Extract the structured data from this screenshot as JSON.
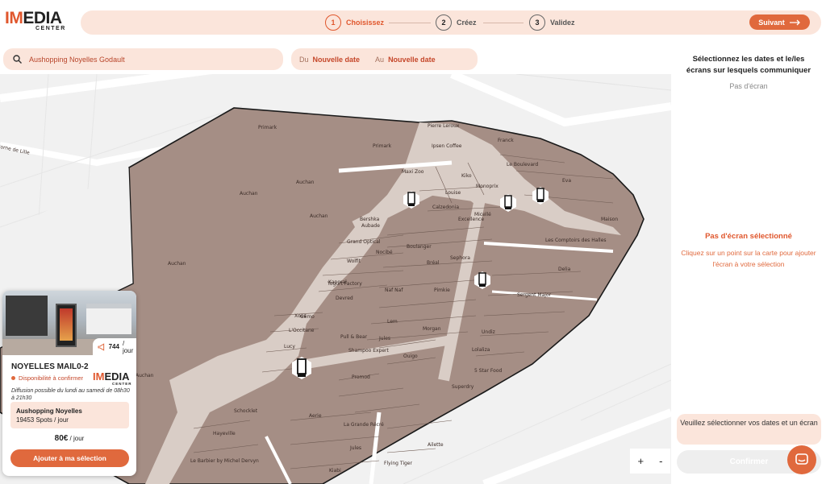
{
  "brand": {
    "logo_letters_red": "IM",
    "logo_letters_dark": "EDIA",
    "logo_sub": "CENTER"
  },
  "stepper": {
    "steps": [
      {
        "num": "1",
        "label": "Choisissez"
      },
      {
        "num": "2",
        "label": "Créez"
      },
      {
        "num": "3",
        "label": "Validez"
      }
    ],
    "next_label": "Suivant",
    "next_icon": "arrow-right-icon"
  },
  "search": {
    "icon": "search-icon",
    "value": "Aushopping Noyelles Godault"
  },
  "dates": {
    "from_prefix": "Du",
    "from_value": "Nouvelle date",
    "to_prefix": "Au",
    "to_value": "Nouvelle date"
  },
  "map": {
    "labels": [
      "Primark",
      "Primark",
      "Pierre Leroux",
      "Ipsen Coffee",
      "Franck",
      "Le Boulevard",
      "Eva",
      "Auchan",
      "Auchan",
      "Auchan",
      "Auchan",
      "Auchan",
      "Maxi Zoo",
      "Louise",
      "Kiko",
      "Monoprix",
      "Calzedonia",
      "Excellence",
      "Micellé",
      "Aubade",
      "Grand Optical",
      "Boulanger",
      "Nocibé",
      "Wolfit",
      "Bréal",
      "Sephora",
      "Les Comptoirs des Halles",
      "Delia",
      "Kaporal",
      "Naf Naf",
      "Pimkie",
      "Sergent Major",
      "Devred",
      "Yogurt Factory",
      "Xoos",
      "Lem",
      "Morgan",
      "Pull & Bear",
      "Jules",
      "Shampoo Expert",
      "Ouigo",
      "Undiz",
      "Lolaliza",
      "5 Star Food",
      "Superdry",
      "Promod",
      "Aerie",
      "Flying Tiger",
      "Jules",
      "Kiabi",
      "Le Barbier by Michel Dervyn",
      "Ailette",
      "Hayeville",
      "Schocklet",
      "La Grande Récré",
      "Bershka",
      "Gémo",
      "Lucy",
      "L'Occitane",
      "Maison"
    ],
    "road_label": "Borne de Lille"
  },
  "card": {
    "spots_per_day": "744",
    "spots_suffix": "/ jour",
    "spot_icon": "megaphone-icon",
    "name": "NOYELLES MAIL0-2",
    "status": "Disponibilité à confirmer",
    "diffusion": "Diffusion possible du lundi au samedi de 08h30 à 21h30",
    "mall_name": "Aushopping Noyelles",
    "spots_line": "19453 Spots / jour",
    "price": "80€",
    "price_suffix": " / jour",
    "add_label": "Ajouter à ma sélection"
  },
  "zoom": {
    "plus": "+",
    "minus": "-"
  },
  "panel": {
    "title": "Sélectionnez les dates et le/les écrans sur lesquels communiquer",
    "no_screen": "Pas d'écran",
    "selected_head": "Pas d'écran sélectionné",
    "selected_hint": "Cliquez sur un point sur la carte pour ajouter l'écran à votre sélection",
    "warning": "Veuillez sélectionner vos dates et un écran",
    "confirm_label": "Confirmer"
  },
  "colors": {
    "accent": "#e0693d",
    "accent_light": "#fbe5db",
    "building": "#a58e85",
    "corridor": "#d9cdc6"
  }
}
